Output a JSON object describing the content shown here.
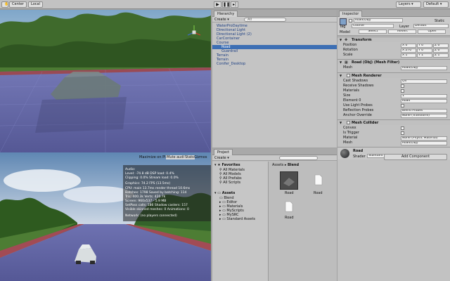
{
  "toolbar": {
    "center_label": "Center",
    "local_label": "Local",
    "layers_label": "Layers",
    "layout_label": "Default"
  },
  "hierarchy": {
    "tab": "Hierarchy",
    "create_label": "Create",
    "search_placeholder": "All",
    "items": [
      {
        "label": "WaterProDaytime",
        "indent": 0,
        "selected": false
      },
      {
        "label": "Directional Light",
        "indent": 0,
        "selected": false
      },
      {
        "label": "Directional Light (2)",
        "indent": 0,
        "selected": false
      },
      {
        "label": "CarContainer",
        "indent": 0,
        "selected": false
      },
      {
        "label": "Course",
        "indent": 0,
        "selected": false
      },
      {
        "label": "Road",
        "indent": 1,
        "selected": true
      },
      {
        "label": "Guardrail",
        "indent": 1,
        "selected": false
      },
      {
        "label": "Terrain",
        "indent": 0,
        "selected": false
      },
      {
        "label": "Terrain",
        "indent": 0,
        "selected": false
      },
      {
        "label": "Conifer_Desktop",
        "indent": 0,
        "selected": false
      }
    ]
  },
  "project": {
    "tab": "Project",
    "create_label": "Create",
    "favorites": {
      "title": "Favorites",
      "items": [
        "All Materials",
        "All Models",
        "All Prefabs",
        "All Scripts"
      ]
    },
    "assets": {
      "title": "Assets",
      "items": [
        "Blend",
        "Editor",
        "Materials",
        "MyScripts",
        "MySRC",
        "Standard Assets"
      ]
    },
    "breadcrumb": {
      "root": "Assets",
      "current": "Blend"
    },
    "grid": [
      {
        "label": "Road",
        "kind": "model"
      },
      {
        "label": "Road",
        "kind": "file"
      },
      {
        "label": "Road",
        "kind": "file"
      }
    ]
  },
  "inspector": {
    "tab": "Inspector",
    "object_name": "Road(Obj)",
    "static_label": "Static",
    "tag_label": "Tag",
    "tag_value": "Course",
    "layer_label": "Layer",
    "layer_value": "Default",
    "model_label": "Model",
    "model_buttons": [
      "Select",
      "Revert",
      "Open"
    ],
    "transform": {
      "title": "Transform",
      "rows": [
        {
          "label": "Position",
          "x": "X 0",
          "y": "Y 0",
          "z": "Z 0"
        },
        {
          "label": "Rotation",
          "x": "X 270",
          "y": "Y 0",
          "z": "Z 0"
        },
        {
          "label": "Scale",
          "x": "X 1",
          "y": "Y 1",
          "z": "Z 1"
        }
      ]
    },
    "mesh_filter": {
      "title": "Road (Obj) (Mesh Filter)",
      "mesh_label": "Mesh",
      "mesh_value": "Road(Obj)"
    },
    "mesh_renderer": {
      "title": "Mesh Renderer",
      "rows": [
        {
          "label": "Cast Shadows",
          "value": "On"
        },
        {
          "label": "Receive Shadows",
          "value": ""
        },
        {
          "label": "Materials",
          "value": ""
        },
        {
          "label": "Size",
          "value": "1"
        },
        {
          "label": "Element 0",
          "value": "Road"
        },
        {
          "label": "Use Light Probes",
          "value": ""
        },
        {
          "label": "Reflection Probes",
          "value": "Blend Probes"
        },
        {
          "label": "Anchor Override",
          "value": "None (Transform)"
        }
      ]
    },
    "mesh_collider": {
      "title": "Mesh Collider",
      "rows": [
        {
          "label": "Convex",
          "value": ""
        },
        {
          "label": "Is Trigger",
          "value": ""
        },
        {
          "label": "Material",
          "value": "None (Physic Material)"
        },
        {
          "label": "Mesh",
          "value": "Road(Obj)"
        }
      ]
    },
    "material": {
      "name": "Road",
      "shader_label": "Shader",
      "shader_value": "Standard"
    },
    "add_component": "Add Component"
  },
  "game_view": {
    "maximize_label": "Maximize on Play",
    "mute_label": "Mute audio",
    "stats_label": "Stats",
    "gizmos_label": "Gizmos",
    "stats": [
      "Audio:",
      "  Level: -74.8 dB          DSP load: 0.4%",
      "  Clipping: 0.0%           Stream load: 0.0%",
      "Graphics:                    74.2 FPS (13.5ms)",
      "  CPU: main 13.7ms    render thread 10.6ms",
      "  Batches: 1798          Saved by batching: 114",
      "  Tris: 400.3k             Verts: 420.7k",
      "  Screen: 960x537 - 5.9 MB",
      "  SetPass calls: 186    Shadow casters: 157",
      "  Visible skinned meshes: 0   Animations: 0",
      "Network: (no players connected)"
    ]
  },
  "colors": {
    "selection": "#3d6fb4",
    "panel": "#c4c4c4",
    "road_far": "#6f73b3",
    "road_near": "#5c5f9d"
  }
}
